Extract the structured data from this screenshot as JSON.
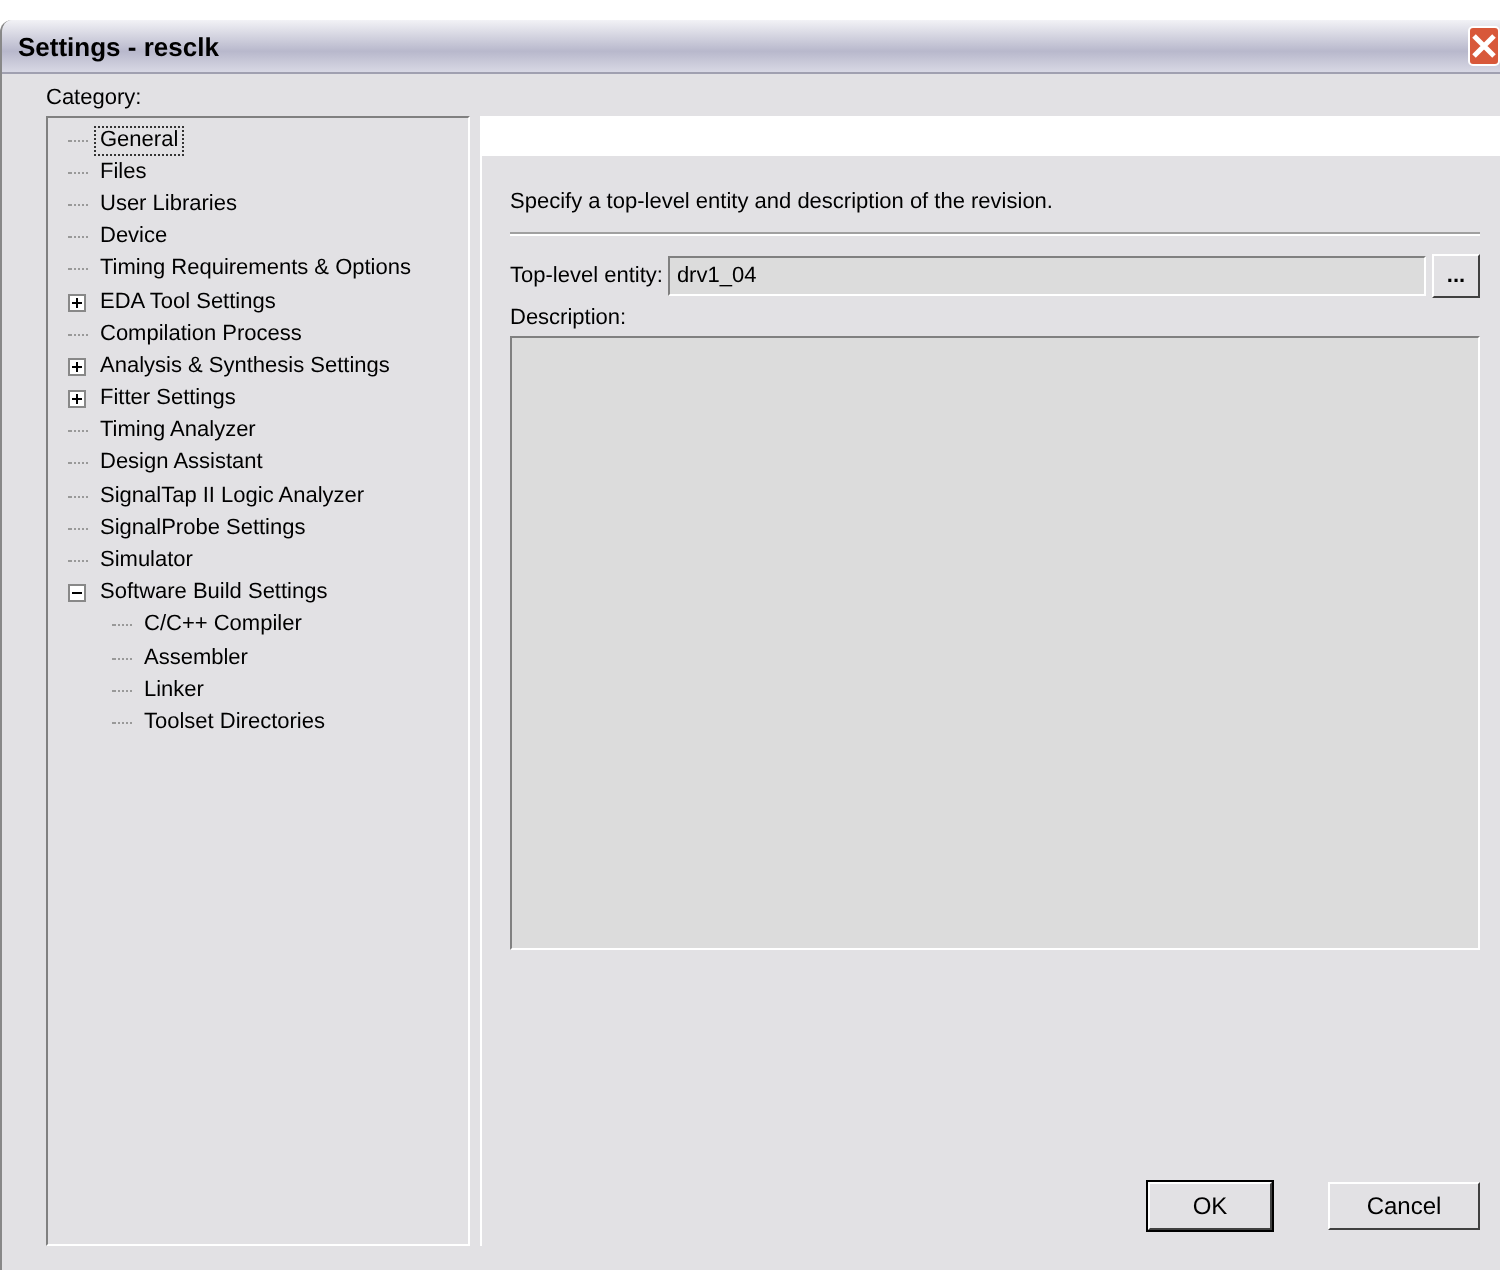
{
  "window": {
    "title": "Settings - resclk"
  },
  "category_label": "Category:",
  "tree": [
    {
      "label": "General",
      "selected": true
    },
    {
      "label": "Files",
      "selected": false
    },
    {
      "label": "User Libraries",
      "selected": false
    },
    {
      "label": "Device",
      "selected": false
    },
    {
      "label": "Timing Requirements & Options",
      "selected": false
    },
    {
      "label": "EDA Tool Settings",
      "selected": false,
      "expanded": false
    },
    {
      "label": "Compilation Process",
      "selected": false
    },
    {
      "label": "Analysis & Synthesis Settings",
      "selected": false,
      "expanded": false
    },
    {
      "label": "Fitter Settings",
      "selected": false,
      "expanded": false
    },
    {
      "label": "Timing Analyzer",
      "selected": false
    },
    {
      "label": "Design Assistant",
      "selected": false
    },
    {
      "label": "SignalTap II Logic Analyzer",
      "selected": false
    },
    {
      "label": "SignalProbe Settings",
      "selected": false
    },
    {
      "label": "Simulator",
      "selected": false
    },
    {
      "label": "Software Build Settings",
      "selected": false,
      "expanded": true,
      "children": [
        {
          "label": "C/C++ Compiler",
          "selected": false
        },
        {
          "label": "Assembler",
          "selected": false
        },
        {
          "label": "Linker",
          "selected": false
        },
        {
          "label": "Toolset Directories",
          "selected": false
        }
      ]
    }
  ],
  "panel": {
    "intro": "Specify a top-level entity and description of the revision.",
    "entity_label": "Top-level entity:",
    "entity_value": "drv1_04",
    "browse_button": "...",
    "description_label": "Description:"
  },
  "buttons": [
    "OK",
    "Cancel"
  ]
}
